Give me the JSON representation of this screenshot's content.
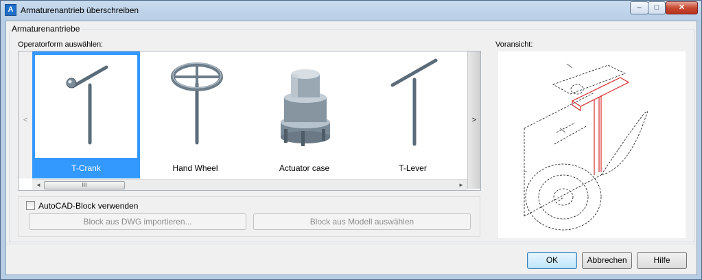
{
  "window": {
    "title": "Armaturenantrieb überschreiben",
    "app_icon": "A",
    "controls": {
      "minimize": "–",
      "maximize": "□",
      "close": "✕"
    }
  },
  "group": {
    "label": "Armaturenantriebe"
  },
  "operator": {
    "label": "Operatorform auswählen:",
    "nav_left": "<",
    "nav_right": ">",
    "items": [
      {
        "label": "T-Crank",
        "selected": true
      },
      {
        "label": "Hand Wheel",
        "selected": false
      },
      {
        "label": "Actuator case",
        "selected": false
      },
      {
        "label": "T-Lever",
        "selected": false
      }
    ],
    "scrollbar": {
      "left": "◄",
      "right": "►",
      "thumb": "III"
    }
  },
  "block": {
    "checkbox_label": "AutoCAD-Block verwenden",
    "checked": false,
    "import_button": "Block aus DWG importieren...",
    "model_button": "Block aus Modell auswählen"
  },
  "preview": {
    "label": "Voransicht:"
  },
  "buttons": {
    "ok": "OK",
    "cancel": "Abbrechen",
    "help": "Hilfe"
  }
}
